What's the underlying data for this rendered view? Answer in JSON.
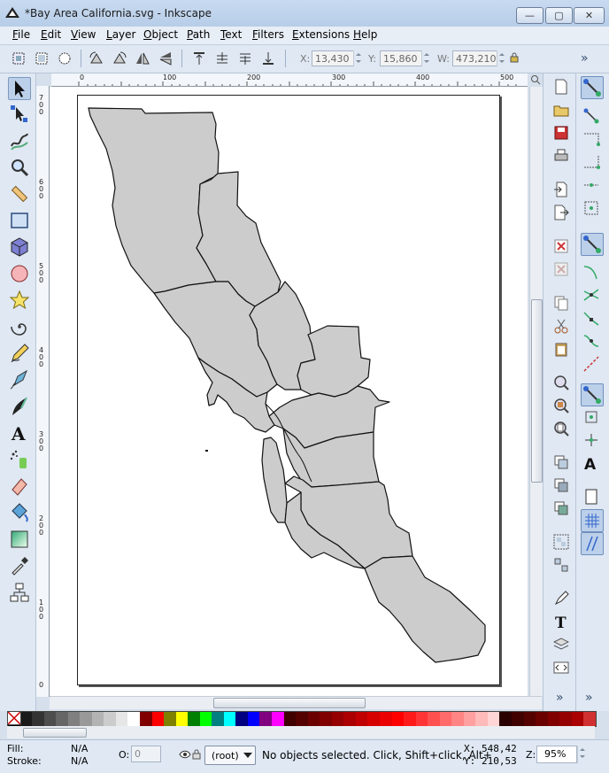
{
  "window": {
    "title": "*Bay Area California.svg - Inkscape",
    "min_glyph": "—",
    "max_glyph": "▢",
    "close_glyph": "✕"
  },
  "menu": [
    "File",
    "Edit",
    "View",
    "Layer",
    "Object",
    "Path",
    "Text",
    "Filters",
    "Extensions",
    "Help"
  ],
  "toolbar": {
    "x_label": "X:",
    "x_value": "13,430",
    "y_label": "Y:",
    "y_value": "15,860",
    "w_label": "W:",
    "w_value": "473,210",
    "overflow": "»"
  },
  "rulers": {
    "top": [
      "0",
      "100",
      "200",
      "300",
      "400",
      "500"
    ],
    "left": [
      "7\n0\n0",
      "6\n0\n0",
      "5\n0\n0",
      "4\n0\n0",
      "3\n0\n0",
      "2\n0\n0",
      "1\n0\n0",
      "0"
    ]
  },
  "status": {
    "fill_label": "Fill:",
    "fill_value": "N/A",
    "stroke_label": "Stroke:",
    "stroke_value": "N/A",
    "opacity_label": "O:",
    "opacity_value": "0",
    "layer": "(root)",
    "message": "No objects selected. Click, Shift+click, Alt+",
    "x_label": "X:",
    "x_value": "548,42",
    "y_label": "Y:",
    "y_value": "210,53",
    "zoom_label": "Z:",
    "zoom_value": "95%"
  },
  "palette_colors": [
    "#000000",
    "#1a1a1a",
    "#333333",
    "#4d4d4d",
    "#666666",
    "#808080",
    "#999999",
    "#b3b3b3",
    "#cccccc",
    "#e6e6e6",
    "#ffffff",
    "#800000",
    "#ff0000",
    "#808000",
    "#ffff00",
    "#008000",
    "#00ff00",
    "#008080",
    "#00ffff",
    "#000080",
    "#0000ff",
    "#800080",
    "#ff00ff",
    "#400000",
    "#550000",
    "#6b0000",
    "#800000",
    "#950000",
    "#aa0000",
    "#c00000",
    "#d50000",
    "#ea0000",
    "#ff0000",
    "#ff1a1a",
    "#ff3535",
    "#ff5050",
    "#ff6a6a",
    "#ff8585",
    "#ffa0a0",
    "#ffbaba",
    "#ffd5d5",
    "#2b0000",
    "#400000",
    "#550000",
    "#6b0000",
    "#800000",
    "#950000",
    "#aa0000",
    "#d03030"
  ]
}
